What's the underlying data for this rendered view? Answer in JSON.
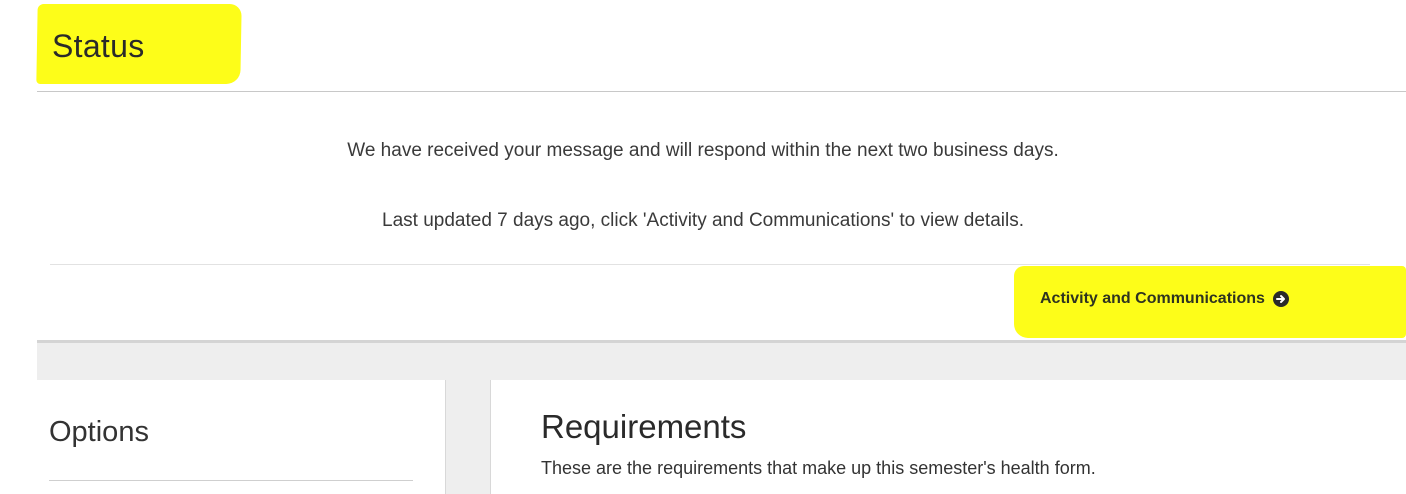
{
  "status": {
    "title": "Status",
    "message": "We have received your message and will respond within the next two business days.",
    "updated": "Last updated 7 days ago, click 'Activity and Communications' to view details."
  },
  "activity_link": {
    "label": "Activity and Communications",
    "icon": "arrow-circle-right-icon"
  },
  "options": {
    "title": "Options"
  },
  "requirements": {
    "title": "Requirements",
    "description": "These are the requirements that make up this semester's health form."
  },
  "colors": {
    "highlight": "#fdfd19",
    "band": "#eeeeee"
  }
}
